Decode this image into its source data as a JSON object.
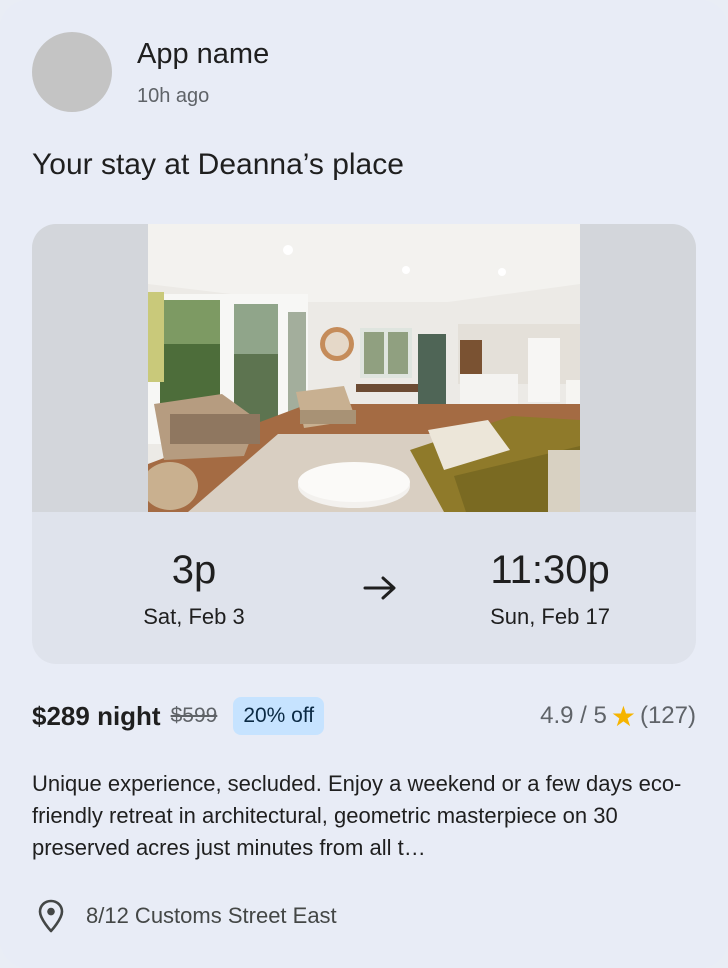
{
  "app": {
    "name": "App name",
    "time_ago": "10h ago"
  },
  "title": "Your stay at Deanna’s place",
  "checkin": {
    "time": "3p",
    "date": "Sat, Feb 3"
  },
  "checkout": {
    "time": "11:30p",
    "date": "Sun, Feb 17"
  },
  "pricing": {
    "price": "$289 night",
    "old_price": "$599",
    "discount": "20% off"
  },
  "rating": {
    "score": "4.9 / 5",
    "count": "(127)",
    "star_color": "#f6b400"
  },
  "description": "Unique experience, secluded. Enjoy a weekend or a few days eco-friendly retreat in architectural, geometric masterpiece on 30 preserved acres just minutes from all t…",
  "location": {
    "address": "8/12 Customs Street East"
  },
  "icons": {
    "arrow": "arrow-right-icon",
    "location": "map-pin-icon",
    "star": "star-icon"
  }
}
